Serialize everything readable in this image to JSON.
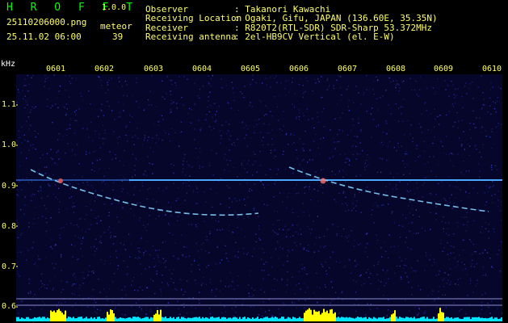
{
  "app": {
    "name": "H R O F F T",
    "version": "1.0.0"
  },
  "file": {
    "name": "25110206000.png",
    "datetime": "25.11.02 06:00"
  },
  "meteor": {
    "label": "meteor",
    "count": "39"
  },
  "station": {
    "observer_label": "Observer",
    "observer_value": ": Takanori Kawachi",
    "location_label": "Receiving Location",
    "location_value": ": Ogaki, Gifu, JAPAN (136.60E, 35.35N)",
    "receiver_label": "Receiver",
    "receiver_value": ": R820T2(RTL-SDR) SDR-Sharp 53.372MHz",
    "antenna_label": "Receiving antenna",
    "antenna_value": ": 2el-HB9CV Vertical (el. E-W)"
  },
  "axis": {
    "unit": "kHz",
    "y_ticks": [
      "1.1",
      "1.0",
      "0.9",
      "0.8",
      "0.7",
      "0.6"
    ],
    "x_ticks": [
      "0601",
      "0602",
      "0603",
      "0604",
      "0605",
      "0606",
      "0607",
      "0608",
      "0609",
      "0610"
    ]
  },
  "colors": {
    "background": "#000000",
    "plot_bg": "#06062b",
    "header_green": "#00ff00",
    "tick_yellow": "#ffff66",
    "carrier": "#4aa8ff",
    "meteor": "#7fd4ff",
    "bar_cyan": "#00e5ff",
    "bar_yellow": "#ffff00"
  }
}
